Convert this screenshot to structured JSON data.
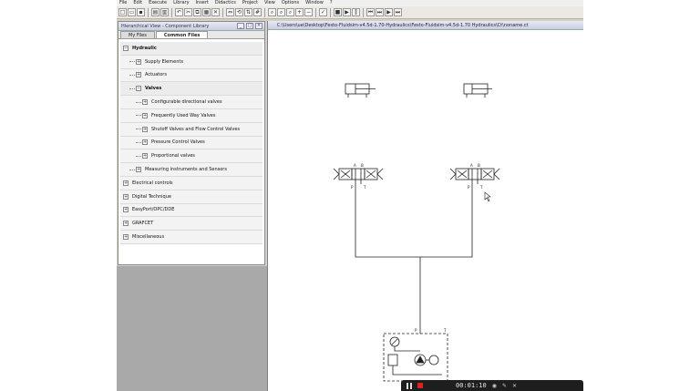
{
  "menu": [
    "File",
    "Edit",
    "Execute",
    "Library",
    "Insert",
    "Didactics",
    "Project",
    "View",
    "Options",
    "Window",
    "?"
  ],
  "library": {
    "title": "Hierarchical View - Component Library",
    "tabs": [
      "My Files",
      "Common Files"
    ],
    "tree": [
      {
        "label": "Hydraulic",
        "level": 0,
        "sign": "−",
        "bold": true
      },
      {
        "label": "Supply Elements",
        "level": 1,
        "sign": "+"
      },
      {
        "label": "Actuators",
        "level": 1,
        "sign": "+"
      },
      {
        "label": "Valves",
        "level": 1,
        "sign": "−",
        "bold": true
      },
      {
        "label": "Configurable directional valves",
        "level": 2,
        "sign": "+"
      },
      {
        "label": "Frequently Used Way Valves",
        "level": 2,
        "sign": "+"
      },
      {
        "label": "Shutoff Valves and Flow Control Valves",
        "level": 2,
        "sign": "+"
      },
      {
        "label": "Pressure Control Valves",
        "level": 2,
        "sign": "+"
      },
      {
        "label": "Proportional valves",
        "level": 2,
        "sign": "+"
      },
      {
        "label": "Measuring instruments and Sensors",
        "level": 1,
        "sign": "+"
      },
      {
        "label": "Electrical controls",
        "level": 0,
        "sign": "+"
      },
      {
        "label": "Digital Technique",
        "level": 0,
        "sign": "+"
      },
      {
        "label": "EasyPort/OPC/DDE",
        "level": 0,
        "sign": "+"
      },
      {
        "label": "GRAFCET",
        "level": 0,
        "sign": "+"
      },
      {
        "label": "Miscellaneous",
        "level": 0,
        "sign": "+"
      }
    ]
  },
  "drawing": {
    "path": "C:\\Users\\ue\\Desktop\\Festo-Fluidsim-v4.5d-1.70-Hydraulics\\Festo-Fluidsim-v4.5d-1.70 Hydraulics\\Ct\\noname.ct",
    "port_labels": {
      "A": "A",
      "B": "B",
      "P": "P",
      "T": "T"
    }
  },
  "recorder": {
    "time": "00:01:10"
  }
}
